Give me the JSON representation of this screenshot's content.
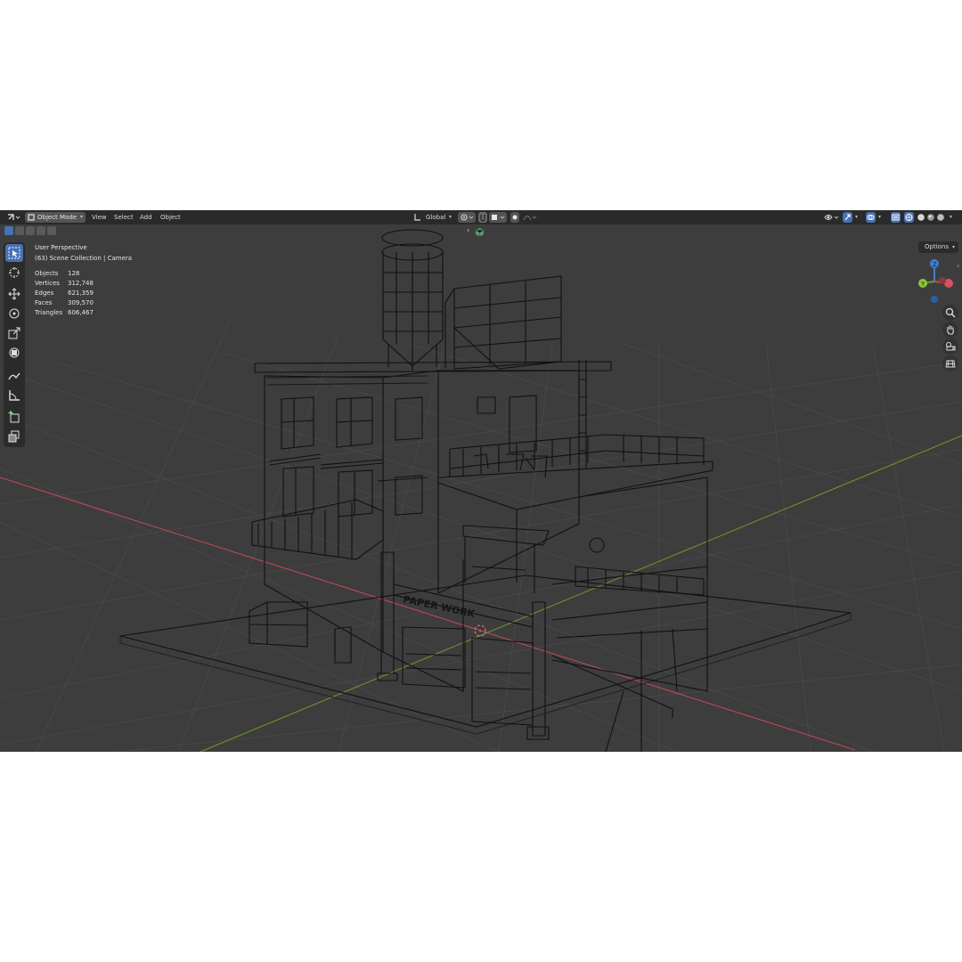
{
  "header": {
    "editor_type_icon": "editor-type-icon",
    "mode_label": "Object Mode",
    "menus": [
      "View",
      "Select",
      "Add",
      "Object"
    ],
    "transform_orientation": "Global",
    "shading_icons": [
      "wireframe",
      "solid",
      "material-preview",
      "rendered"
    ]
  },
  "viewport": {
    "view_name": "User Perspective",
    "collection_info": "(63) Scene Collection | Camera",
    "options_label": "Options",
    "stats": [
      {
        "label": "Objects",
        "value": "128"
      },
      {
        "label": "Vertices",
        "value": "312,748"
      },
      {
        "label": "Edges",
        "value": "621,359"
      },
      {
        "label": "Faces",
        "value": "309,570"
      },
      {
        "label": "Triangles",
        "value": "606,467"
      }
    ],
    "gizmo_axes": [
      "Z",
      "Y",
      "X"
    ]
  },
  "tools": [
    "select-box",
    "cursor",
    "move",
    "rotate",
    "scale",
    "transform",
    "annotate",
    "measure",
    "add-cube",
    "extrude"
  ],
  "colors": {
    "header_bg": "#2a2a2a",
    "viewport_bg": "#3d3d3d",
    "active_tool": "#4772b3",
    "axis_x": "#c74a56",
    "axis_y": "#6d9b2a",
    "axis_z": "#3f7fd0",
    "wire": "#111111"
  },
  "sign_text": "PAPER WORK"
}
